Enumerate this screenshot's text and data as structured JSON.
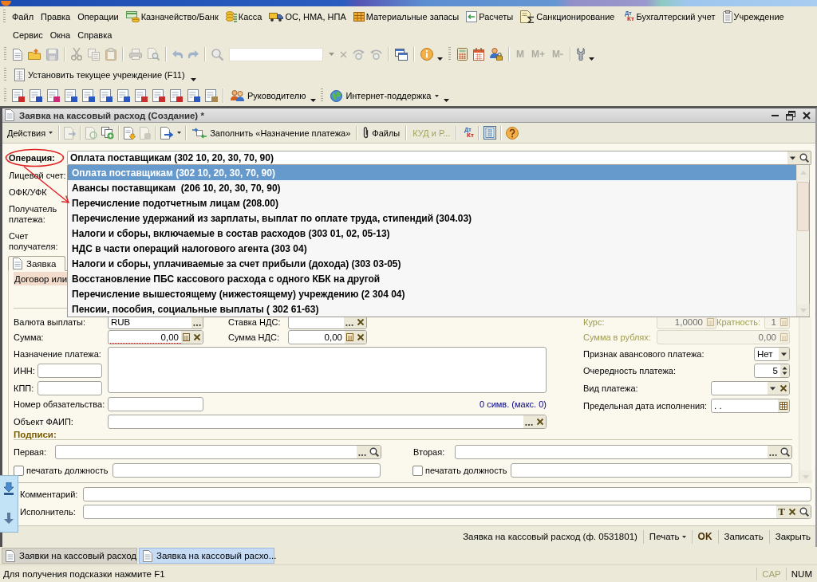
{
  "menu_bar": {
    "rows": [
      [
        {
          "label": "Файл"
        },
        {
          "label": "Правка"
        },
        {
          "label": "Операции"
        },
        {
          "label": "Казначейство/Банк"
        },
        {
          "label": "Касса"
        },
        {
          "label": "ОС, НМА, НПА"
        },
        {
          "label": "Материальные запасы"
        },
        {
          "label": "Расчеты"
        },
        {
          "label": "Санкционирование"
        },
        {
          "label": "Бухгалтерский учет",
          "marks": [
            "Дт",
            "Кт"
          ]
        },
        {
          "label": "Учреждение"
        }
      ],
      [
        {
          "label": "Сервис"
        },
        {
          "label": "Окна"
        },
        {
          "label": "Справка"
        }
      ]
    ]
  },
  "main_toolbar": {
    "buttons": [
      {
        "disabled": false
      },
      {
        "disabled": false
      },
      {
        "disabled": true
      },
      {
        "disabled": true
      },
      {
        "disabled": true
      },
      {
        "disabled": true
      },
      {
        "disabled": true
      },
      {
        "disabled": true
      },
      {
        "disabled": true
      },
      {
        "disabled": true
      },
      {
        "disabled": true
      },
      {
        "disabled": true
      },
      {
        "disabled": true
      },
      {
        "disabled": true
      },
      {
        "disabled": true
      },
      {
        "disabled": false
      },
      {
        "disabled": false
      },
      {
        "disabled": false
      },
      {
        "disabled": false
      },
      {
        "disabled": false
      },
      {
        "disabled": false
      }
    ],
    "memory_buttons": [
      {
        "label": "M",
        "disabled": true
      },
      {
        "label": "M+",
        "disabled": true
      },
      {
        "label": "M-",
        "disabled": true
      }
    ]
  },
  "institution_toolbar": {
    "button": "Установить текущее учреждение (F11)"
  },
  "reports_toolbar": {
    "buttons": [
      "Руководителю",
      "Интернет-поддержка"
    ]
  },
  "document_window": {
    "title": "Заявка на кассовый расход (Создание) *",
    "toolbar": {
      "actions_button": "Действия",
      "icon_buttons": [
        {
          "disabled": true
        },
        {
          "disabled": true
        },
        {
          "disabled": false
        },
        {
          "disabled": false
        },
        {
          "disabled": true
        },
        {
          "disabled": false
        }
      ],
      "fill_button": "Заполнить «Назначение платежа»",
      "files_button": "Файлы",
      "kud_button": {
        "label": "КУД и Р...",
        "disabled": true
      },
      "debit_credit_button": [
        "Дт",
        "Кт"
      ]
    },
    "operation": {
      "label": "Операция:",
      "value": "Оплата поставщикам (302 10, 20, 30, 70, 90)",
      "expanded": true,
      "annotated": true,
      "options": [
        {
          "label": "Оплата поставщикам (302 10, 20, 30, 70, 90)",
          "selected": true
        },
        {
          "label": "Авансы поставщикам  (206 10, 20, 30, 70, 90)",
          "selected": false
        },
        {
          "label": "Перечисление подотчетным лицам (208.00)",
          "selected": false
        },
        {
          "label": "Перечисление удержаний из зарплаты, выплат по оплате труда, стипендий (304.03)",
          "selected": false
        },
        {
          "label": "Налоги и сборы, включаемые в состав расходов (303 01, 02, 05-13)",
          "selected": false
        },
        {
          "label": "НДС в части операций налогового агента (303 04)",
          "selected": false
        },
        {
          "label": "Налоги и сборы, уплачиваемые за счет прибыли (дохода) (303 03-05)",
          "selected": false
        },
        {
          "label": "Восстановление ПБС кассового расхода с одного КБК на другой",
          "selected": false
        },
        {
          "label": "Перечисление вышестоящему (нижестоящему) учреждению (2 304 04)",
          "selected": false
        },
        {
          "label": "Пенсии, пособия, социальные выплаты ( 302 61-63)",
          "selected": false
        }
      ]
    },
    "header_labels": [
      "Лицевой счет:",
      "ОФК/УФК",
      "Получатель платежа:",
      "Счет получателя:"
    ],
    "tabs": [
      {
        "label": "Заявка",
        "selected": true
      }
    ],
    "contract_label": "Договор или",
    "currency": {
      "label": "Валюта выплаты:",
      "value": "RUB"
    },
    "vat_rate": {
      "label": "Ставка НДС:"
    },
    "amount": {
      "label": "Сумма:",
      "value": "0,00",
      "required": true
    },
    "vat_amount": {
      "label": "Сумма НДС:",
      "value": "0,00"
    },
    "purpose": {
      "label": "Назначение платежа:",
      "counter": "0 симв. (макс. 0)"
    },
    "inn": {
      "label": "ИНН:"
    },
    "kpp": {
      "label": "КПП:"
    },
    "obligation": {
      "label": "Номер обязательства:"
    },
    "faip": {
      "label": "Объект ФАИП:"
    },
    "rate": {
      "label": "Курс:",
      "value": "1,0000",
      "disabled": true
    },
    "multiplicity": {
      "label": "Кратность:",
      "value": "1",
      "disabled": true
    },
    "amount_rub": {
      "label": "Сумма в рублях:",
      "value": "0,00",
      "disabled": true
    },
    "advance_flag": {
      "label": "Признак авансового платежа:",
      "value": "Нет"
    },
    "priority": {
      "label": "Очередность платежа:",
      "value": "5"
    },
    "payment_type": {
      "label": "Вид платежа:"
    },
    "deadline": {
      "label": "Предельная дата исполнения:",
      "value": ". ."
    },
    "signatures": {
      "title": "Подписи:",
      "items": [
        {
          "label": "Первая:",
          "print_label": "печатать должность",
          "print_checked": false
        },
        {
          "label": "Вторая:",
          "print_label": "печатать должность",
          "print_checked": false
        }
      ]
    },
    "comment": {
      "label": "Комментарий:"
    },
    "executor": {
      "label": "Исполнитель:",
      "text_button": "T"
    },
    "footer": {
      "print_form_button": "Заявка на кассовый расход (ф. 0531801)",
      "print_button": "Печать",
      "ok_button": "OK",
      "save_button": "Записать",
      "close_button": "Закрыть"
    }
  },
  "window_tabs": [
    {
      "label": "Заявки на кассовый расход",
      "selected": false
    },
    {
      "label": "Заявка на кассовый расхо...",
      "selected": true
    }
  ],
  "status_bar": {
    "hint": "Для получения подсказки нажмите F1",
    "indicators": [
      {
        "label": "CAP",
        "on": false
      },
      {
        "label": "NUM",
        "on": true
      }
    ]
  }
}
